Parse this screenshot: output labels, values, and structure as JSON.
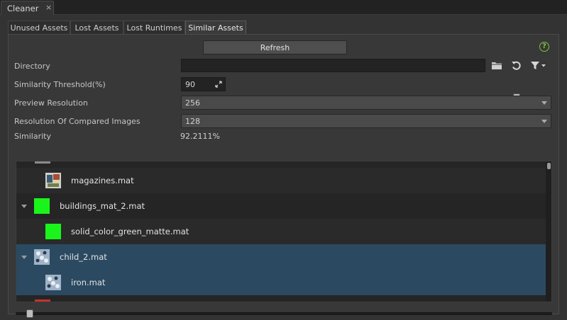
{
  "window": {
    "tab_title": "Cleaner",
    "close_glyph": "×"
  },
  "tabs": [
    {
      "label": "Unused Assets",
      "active": false
    },
    {
      "label": "Lost Assets",
      "active": false
    },
    {
      "label": "Lost Runtimes",
      "active": false
    },
    {
      "label": "Similar Assets",
      "active": true
    }
  ],
  "toolbar": {
    "refresh_label": "Refresh",
    "help_glyph": "?"
  },
  "form": {
    "directory_label": "Directory",
    "directory_value": "",
    "threshold_label": "Similarity Threshold(%)",
    "threshold_value": "90",
    "threshold_slider_fraction": 0.9,
    "preview_label": "Preview Resolution",
    "preview_value": "256",
    "compared_label": "Resolution Of Compared Images",
    "compared_value": "128",
    "similarity_label": "Similarity",
    "similarity_value": "92.2111%"
  },
  "results": [
    {
      "name": "magazines.mat",
      "level": 1,
      "thumb": "magazine-thumbnail",
      "selected": false
    },
    {
      "name": "buildings_mat_2.mat",
      "level": 0,
      "thumb": "green-swatch",
      "selected": false,
      "expanded": true
    },
    {
      "name": "solid_color_green_matte.mat",
      "level": 1,
      "thumb": "green-swatch",
      "selected": false
    },
    {
      "name": "child_2.mat",
      "level": 0,
      "thumb": "iron-texture",
      "selected": true,
      "expanded": true
    },
    {
      "name": "iron.mat",
      "level": 1,
      "thumb": "iron-texture",
      "selected": true
    }
  ],
  "bottom_slider_fraction": 0.02,
  "colors": {
    "accent_green": "#7fc241",
    "selected_row": "#2b4a61",
    "swatch_green": "#19f51a",
    "partial_red": "#c33232"
  }
}
